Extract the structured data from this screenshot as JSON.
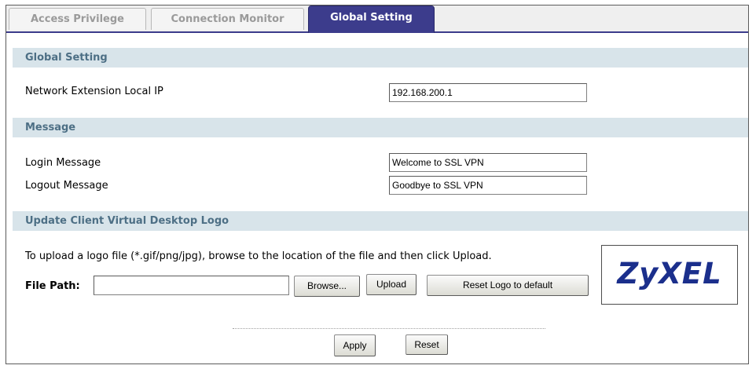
{
  "tabs": {
    "access_privilege": "Access Privilege",
    "connection_monitor": "Connection Monitor",
    "global_setting": "Global Setting",
    "active": "global_setting"
  },
  "sections": {
    "global_setting": {
      "title": "Global Setting",
      "network_extension_label": "Network Extension Local IP",
      "network_extension_value": "192.168.200.1"
    },
    "message": {
      "title": "Message",
      "login_label": "Login Message",
      "login_value": "Welcome to SSL VPN",
      "logout_label": "Logout Message",
      "logout_value": "Goodbye to SSL VPN"
    },
    "logo": {
      "title": "Update Client Virtual Desktop Logo",
      "instructions": "To upload a logo file (*.gif/png/jpg), browse to the location of the file and then click Upload.",
      "file_path_label": "File Path:",
      "file_path_value": "",
      "browse_label": "Browse...",
      "upload_label": "Upload",
      "reset_logo_label": "Reset Logo to default",
      "logo_text": "ZyXEL"
    }
  },
  "actions": {
    "apply_label": "Apply",
    "reset_label": "Reset"
  },
  "colors": {
    "active_tab": "#3c3c8c",
    "section_header_bg": "#d8e4ea",
    "section_header_text": "#4d6f85",
    "logo": "#1b2f8c"
  }
}
